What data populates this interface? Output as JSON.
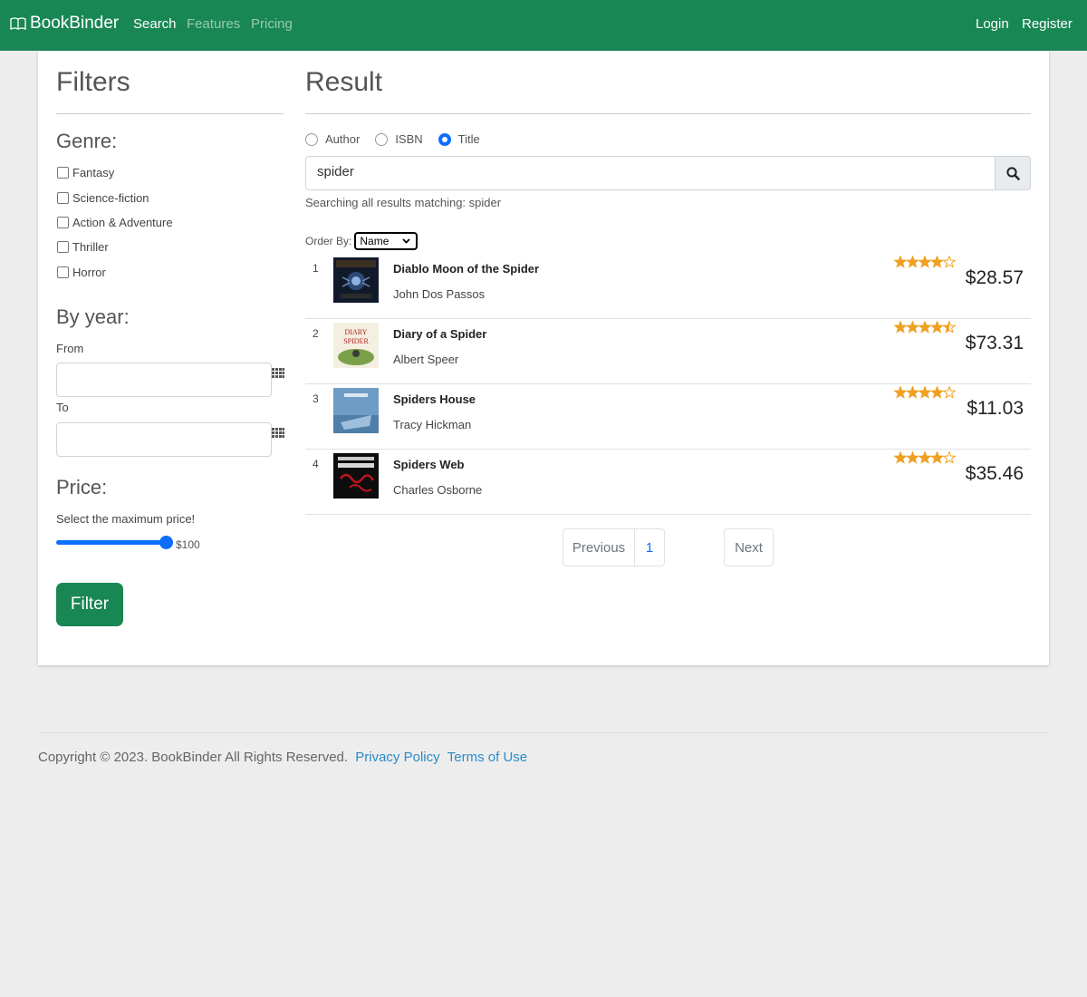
{
  "navbar": {
    "brand": "BookBinder",
    "links": [
      "Search",
      "Features",
      "Pricing"
    ],
    "login": "Login",
    "register": "Register",
    "bg_color": "#198754"
  },
  "filters": {
    "heading": "Filters",
    "genre_heading": "Genre:",
    "genres": [
      "Fantasy",
      "Science-fiction",
      "Action & Adventure",
      "Thriller",
      "Horror"
    ],
    "year_heading": "By year:",
    "from_label": "From",
    "to_label": "To",
    "price_heading": "Price:",
    "price_hint": "Select the maximum price!",
    "price_value": "$100",
    "price_fraction": 1.0,
    "filter_button": "Filter"
  },
  "result": {
    "heading": "Result",
    "search_types": [
      "Author",
      "ISBN",
      "Title"
    ],
    "selected_search_type": "Title",
    "query": "spider",
    "status": "Searching all results matching: spider",
    "order_label": "Order By:",
    "order_value": "Name",
    "books": [
      {
        "index": "1",
        "title": "Diablo Moon of the Spider",
        "author": "John Dos Passos",
        "price": "$28.57",
        "rating": 4
      },
      {
        "index": "2",
        "title": "Diary of a Spider",
        "author": "Albert Speer",
        "price": "$73.31",
        "rating": 4.5
      },
      {
        "index": "3",
        "title": "Spiders House",
        "author": "Tracy Hickman",
        "price": "$11.03",
        "rating": 4
      },
      {
        "index": "4",
        "title": "Spiders Web",
        "author": "Charles Osborne",
        "price": "$35.46",
        "rating": 4
      }
    ],
    "pagination": {
      "previous": "Previous",
      "page": "1",
      "next": "Next"
    }
  },
  "footer": {
    "copyright": "Copyright © 2023. BookBinder All Rights Reserved.",
    "privacy": "Privacy Policy",
    "terms": "Terms of Use"
  }
}
